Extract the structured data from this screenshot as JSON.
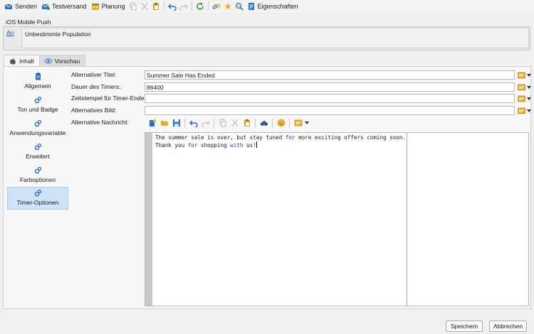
{
  "toolbar": {
    "send_label": "Senden",
    "proof_label": "Testversand",
    "schedule_label": "Planung",
    "properties_label": "Eigenschaften"
  },
  "header": {
    "title": "iOS Mobile Push",
    "to_link": "An",
    "target_value": "Unbestimmte Population"
  },
  "tabs": [
    {
      "label": "Inhalt",
      "icon": "apple-icon",
      "active": true
    },
    {
      "label": "Vorschau",
      "icon": "eye-icon",
      "active": false
    }
  ],
  "sidebar": {
    "items": [
      {
        "label": "Allgemein",
        "icon": "clipboard-icon"
      },
      {
        "label": "Ton und Badge",
        "icon": "gears-icon"
      },
      {
        "label": "Anwendungsvariable",
        "icon": "gears-icon"
      },
      {
        "label": "Erweitert",
        "icon": "gears-icon"
      },
      {
        "label": "Farboptionen",
        "icon": "gears-icon"
      },
      {
        "label": "Timer-Optionen",
        "icon": "gears-icon",
        "selected": true
      }
    ]
  },
  "form": {
    "alt_title_label": "Alternativer Titel:",
    "alt_title_value": "Summer Sale Has Ended",
    "timer_duration_label": "Dauer des Timers:",
    "timer_duration_value": "86400",
    "timer_end_label": "Zeitstempel für Timer-Ende:",
    "timer_end_value": "",
    "alt_image_label": "Alternatives Bild:",
    "alt_image_value": "",
    "alt_message_label": "Alternative Nachricht:"
  },
  "editor": {
    "line1_a": "The summer sale is over, but stay tuned ",
    "line1_kw": "for",
    "line1_b": " more exciting offers coming soon.",
    "line2_a": "Thank you ",
    "line2_kw1": "for",
    "line2_b": " shopping ",
    "line2_kw2": "with",
    "line2_c": " us!"
  },
  "footer": {
    "save_label": "Speichern",
    "cancel_label": "Abbrechen"
  },
  "colors": {
    "accent_blue": "#1f6fc8",
    "selected_bg": "#cfe3f8",
    "keyword": "#1f3fbf"
  }
}
